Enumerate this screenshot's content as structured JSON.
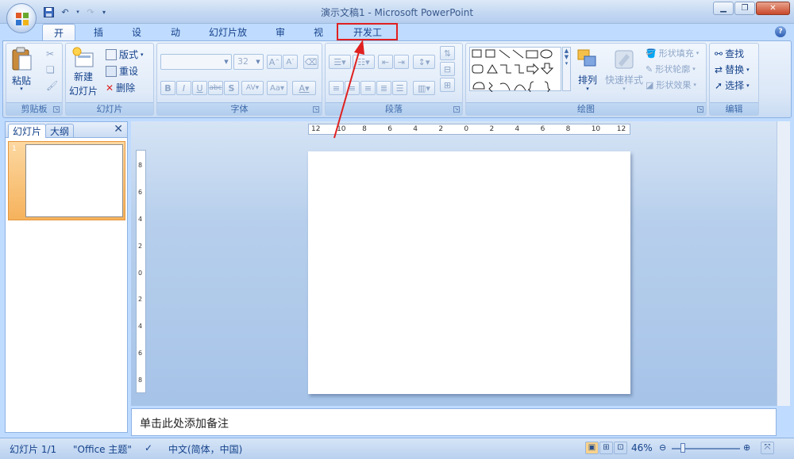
{
  "window": {
    "title": "演示文稿1 - Microsoft PowerPoint"
  },
  "qat": {
    "save_icon": "save-icon",
    "undo_icon": "undo-icon",
    "redo_icon": "redo-icon",
    "customize_icon": "chevron-down-icon"
  },
  "tabs": [
    {
      "label": "开始",
      "active": true
    },
    {
      "label": "插入"
    },
    {
      "label": "设计"
    },
    {
      "label": "动画"
    },
    {
      "label": "幻灯片放映"
    },
    {
      "label": "审阅"
    },
    {
      "label": "视图"
    },
    {
      "label": "开发工具",
      "highlighted": true
    }
  ],
  "ribbon": {
    "clipboard": {
      "label": "剪贴板",
      "paste": "粘贴"
    },
    "slides": {
      "label": "幻灯片",
      "new_slide_line1": "新建",
      "new_slide_line2": "幻灯片",
      "layout": "版式",
      "reset": "重设",
      "delete": "删除"
    },
    "font": {
      "label": "字体",
      "font_name": "",
      "font_size": "32"
    },
    "paragraph": {
      "label": "段落"
    },
    "drawing": {
      "label": "绘图",
      "arrange": "排列",
      "quick_styles": "快速样式",
      "shape_fill": "形状填充",
      "shape_outline": "形状轮廓",
      "shape_effects": "形状效果"
    },
    "editing": {
      "label": "编辑",
      "find": "查找",
      "replace": "替换",
      "select": "选择"
    }
  },
  "left_pane": {
    "tab_slides": "幻灯片",
    "tab_outline": "大纲",
    "slide_number": "1"
  },
  "ruler": {
    "h_labels": [
      "12",
      "10",
      "8",
      "6",
      "4",
      "2",
      "0",
      "2",
      "4",
      "6",
      "8",
      "10",
      "12"
    ],
    "v_labels": [
      "8",
      "6",
      "4",
      "2",
      "0",
      "2",
      "4",
      "6",
      "8"
    ]
  },
  "notes": {
    "placeholder": "单击此处添加备注"
  },
  "status": {
    "slide": "幻灯片 1/1",
    "theme": "\"Office 主题\"",
    "language": "中文(简体，中国)",
    "zoom": "46%"
  },
  "colors": {
    "highlight": "#e02020",
    "ribbon_bg": "#dbe7f7",
    "selected_thumb": "#f6b25c"
  }
}
